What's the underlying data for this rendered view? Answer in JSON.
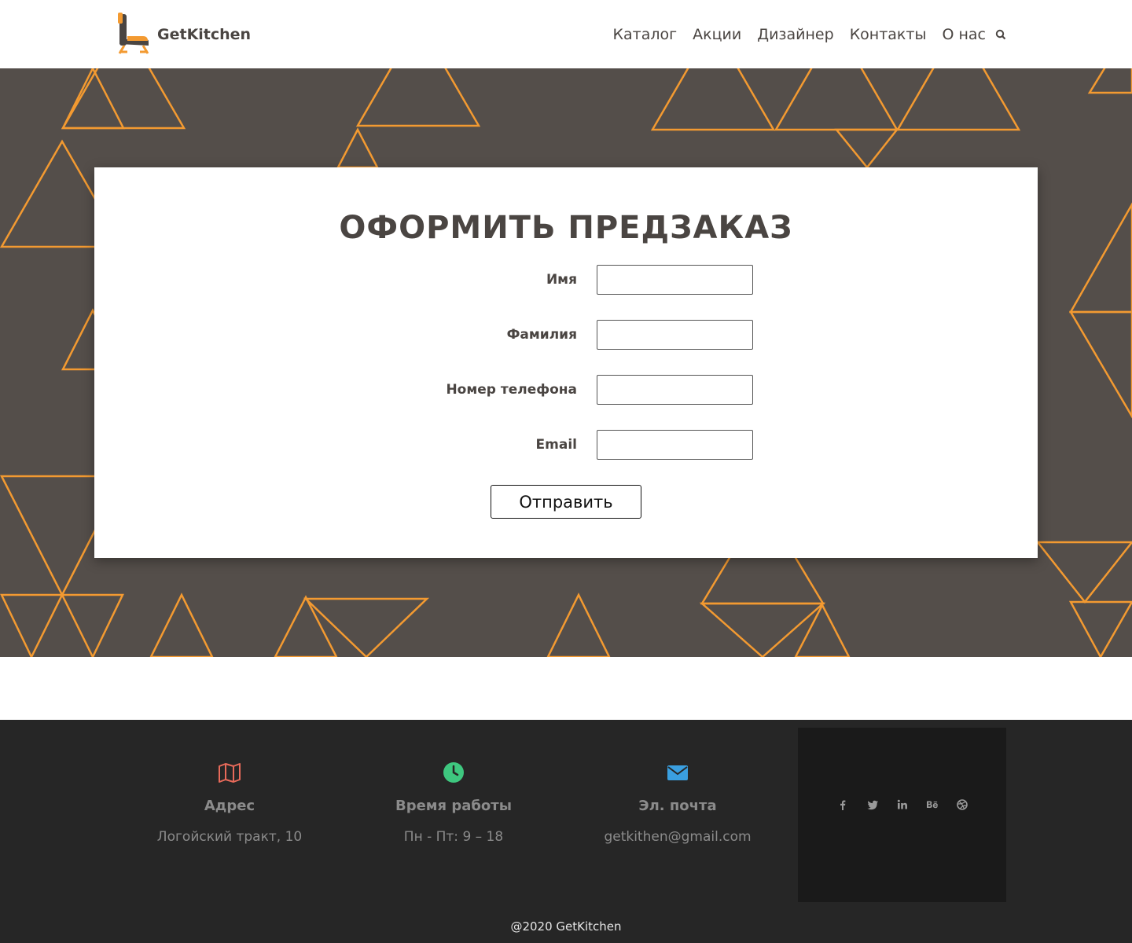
{
  "header": {
    "brand": "GetKitchen",
    "nav": [
      "Каталог",
      "Акции",
      "Дизайнер",
      "Контакты",
      "О нас"
    ],
    "accent_color": "#f39a31"
  },
  "form": {
    "title": "ОФОРМИТЬ ПРЕДЗАКАЗ",
    "fields": [
      {
        "label": "Имя",
        "value": "",
        "placeholder": ""
      },
      {
        "label": "Фамилия",
        "value": "",
        "placeholder": ""
      },
      {
        "label": "Номер телефона",
        "value": "",
        "placeholder": ""
      },
      {
        "label": "Email",
        "value": "",
        "placeholder": ""
      }
    ],
    "submit_label": "Отправить"
  },
  "footer": {
    "columns": [
      {
        "icon": "map-icon",
        "heading": "Адрес",
        "value": "Логойский тракт, 10",
        "color": "#e86a5a"
      },
      {
        "icon": "clock-icon",
        "heading": "Время работы",
        "value": "Пн - Пт: 9 – 18",
        "color": "#3ec77f"
      },
      {
        "icon": "envelope-icon",
        "heading": "Эл. почта",
        "value": "getkithen@gmail.com",
        "color": "#3a9fe0"
      }
    ],
    "social": [
      "facebook-icon",
      "twitter-icon",
      "linkedin-icon",
      "behance-icon",
      "dribbble-icon"
    ],
    "copyright": "@2020 GetKitchen"
  },
  "colors": {
    "hero_background": "#544e4a",
    "pattern": "#f39a31",
    "footer_background": "#262626"
  }
}
